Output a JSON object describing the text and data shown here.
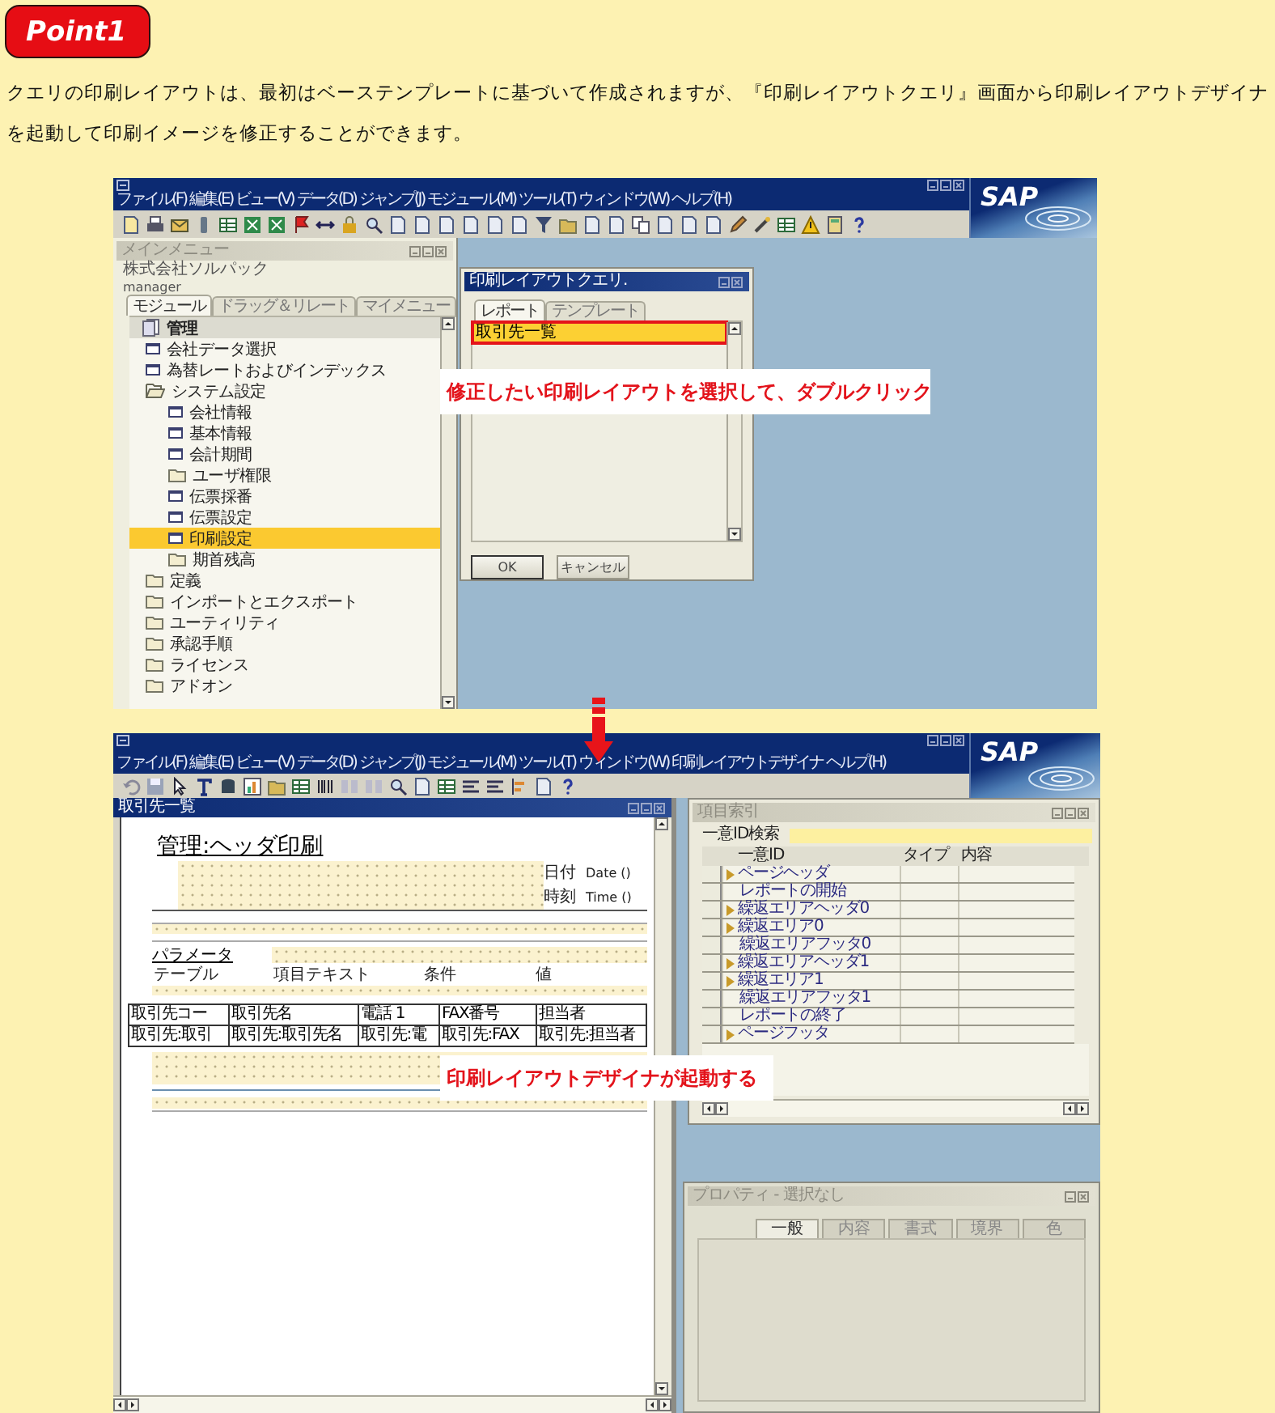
{
  "badge": "Point1",
  "intro": "クエリの印刷レイアウトは、最初はベーステンプレートに基づいて作成されますが、『印刷レイアウトクエリ』画面から印刷レイアウトデザイナを起動して印刷イメージを修正することができます。",
  "screen_1": {
    "logo": "SAP",
    "menu": [
      "ファイル(F)",
      "編集(E)",
      "ビュー(V)",
      "データ(D)",
      "ジャンプ(J)",
      "モジュール(M)",
      "ツール(T)",
      "ウィンドウ(W)",
      "ヘルプ(H)"
    ],
    "main_menu": {
      "title": "メインメニュー",
      "company": "株式会社ソルパック",
      "user": "manager",
      "tabs": [
        {
          "label": "モジュール",
          "selected": true
        },
        {
          "label": "ドラッグ＆リレート",
          "selected": false
        },
        {
          "label": "マイメニュー",
          "selected": false
        }
      ],
      "tree": [
        {
          "label": "管理",
          "kind": "module",
          "expanded": true,
          "selected": false,
          "children": [
            {
              "label": "会社データ選択",
              "kind": "form",
              "selected": false
            },
            {
              "label": "為替レートおよびインデックス",
              "kind": "form",
              "selected": false
            },
            {
              "label": "システム設定",
              "kind": "folder",
              "expanded": true,
              "selected": false,
              "children": [
                {
                  "label": "会社情報",
                  "kind": "form",
                  "selected": false
                },
                {
                  "label": "基本情報",
                  "kind": "form",
                  "selected": false
                },
                {
                  "label": "会計期間",
                  "kind": "form",
                  "selected": false
                },
                {
                  "label": "ユーザ権限",
                  "kind": "folder",
                  "expanded": false,
                  "selected": false
                },
                {
                  "label": "伝票採番",
                  "kind": "form",
                  "selected": false
                },
                {
                  "label": "伝票設定",
                  "kind": "form",
                  "selected": false
                },
                {
                  "label": "印刷設定",
                  "kind": "form",
                  "selected": true
                },
                {
                  "label": "期首残高",
                  "kind": "folder",
                  "expanded": false,
                  "selected": false
                }
              ]
            },
            {
              "label": "定義",
              "kind": "folder",
              "expanded": false,
              "selected": false
            },
            {
              "label": "インポートとエクスポート",
              "kind": "folder",
              "expanded": false,
              "selected": false
            },
            {
              "label": "ユーティリティ",
              "kind": "folder",
              "expanded": false,
              "selected": false
            },
            {
              "label": "承認手順",
              "kind": "folder",
              "expanded": false,
              "selected": false
            },
            {
              "label": "ライセンス",
              "kind": "folder",
              "expanded": false,
              "selected": false
            },
            {
              "label": "アドオン",
              "kind": "folder",
              "expanded": false,
              "selected": false
            }
          ]
        }
      ]
    },
    "dialog": {
      "title": "印刷レイアウトクエリ.",
      "tabs": [
        {
          "label": "レポート",
          "selected": true
        },
        {
          "label": "テンプレート",
          "selected": false
        }
      ],
      "rows": [
        {
          "label": "取引先一覧",
          "selected": true
        }
      ],
      "buttons": [
        "OK",
        "キャンセル"
      ]
    },
    "callout": "修正したい印刷レイアウトを選択して、ダブルクリック"
  },
  "screen_2": {
    "logo": "SAP",
    "menu": [
      "ファイル(F)",
      "編集(E)",
      "ビュー(V)",
      "データ(D)",
      "ジャンプ(J)",
      "モジュール(M)",
      "ツール(T)",
      "ウィンドウ(W)",
      "印刷レイアウトデザイナ",
      "ヘルプ(H)"
    ],
    "layout_window": {
      "title": "取引先一覧",
      "heading": "管理:ヘッダ印刷",
      "date_label": "日付",
      "date_value": "Date ()",
      "time_label": "時刻",
      "time_value": "Time ()",
      "parameter_label": "パラメータ",
      "parameter_columns": [
        "テーブル",
        "項目テキスト",
        "条件",
        "値"
      ],
      "table_columns": [
        "取引先コー",
        "取引先名",
        "電話 1",
        "FAX番号",
        "担当者"
      ],
      "table_row": [
        "取引先:取引",
        "取引先:取引先名",
        "取引先:電",
        "取引先:FAX",
        "取引先:担当者"
      ]
    },
    "field_index": {
      "title": "項目索引",
      "search_label": "一意ID検索",
      "columns": [
        "一意ID",
        "タイプ",
        "内容"
      ],
      "rows": [
        {
          "label": "ページヘッダ",
          "kind": "node"
        },
        {
          "label": "レポートの開始",
          "kind": "leaf"
        },
        {
          "label": "繰返エリアヘッダ0",
          "kind": "node"
        },
        {
          "label": "繰返エリア0",
          "kind": "node"
        },
        {
          "label": "繰返エリアフッタ0",
          "kind": "leaf"
        },
        {
          "label": "繰返エリアヘッダ1",
          "kind": "node"
        },
        {
          "label": "繰返エリア1",
          "kind": "node"
        },
        {
          "label": "繰返エリアフッタ1",
          "kind": "leaf"
        },
        {
          "label": "レポートの終了",
          "kind": "leaf"
        },
        {
          "label": "ページフッタ",
          "kind": "node"
        }
      ]
    },
    "properties": {
      "title": "プロパティ - 選択なし",
      "tabs": [
        {
          "label": "一般",
          "selected": true
        },
        {
          "label": "内容",
          "selected": false
        },
        {
          "label": "書式",
          "selected": false
        },
        {
          "label": "境界",
          "selected": false
        },
        {
          "label": "色",
          "selected": false
        }
      ]
    },
    "callout": "印刷レイアウトデザイナが起動する"
  }
}
